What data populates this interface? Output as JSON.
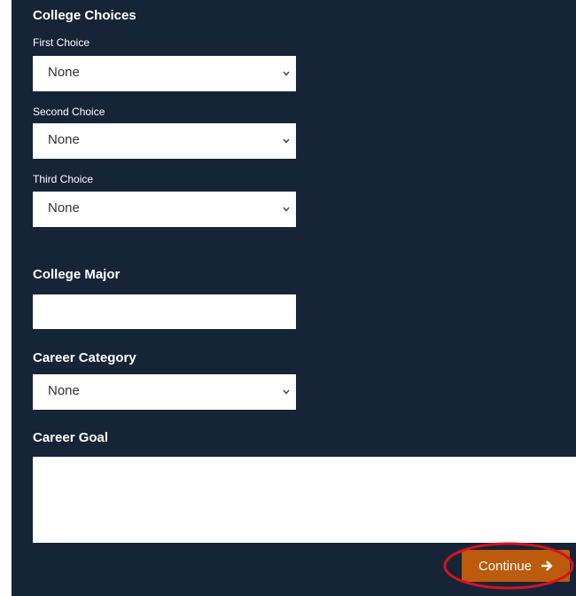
{
  "form": {
    "college_choices_heading": "College Choices",
    "first_choice": {
      "label": "First Choice",
      "value": "None"
    },
    "second_choice": {
      "label": "Second Choice",
      "value": "None"
    },
    "third_choice": {
      "label": "Third Choice",
      "value": "None"
    },
    "college_major": {
      "label": "College Major",
      "value": ""
    },
    "career_category": {
      "label": "Career Category",
      "value": "None"
    },
    "career_goal": {
      "label": "Career Goal",
      "value": ""
    },
    "continue_button": {
      "label": "Continue",
      "icon": "arrow-right-icon"
    }
  },
  "colors": {
    "panel_background": "#162438",
    "button_background": "#bd5b0c",
    "highlight_ring": "#d4141c",
    "input_background": "#ffffff"
  }
}
